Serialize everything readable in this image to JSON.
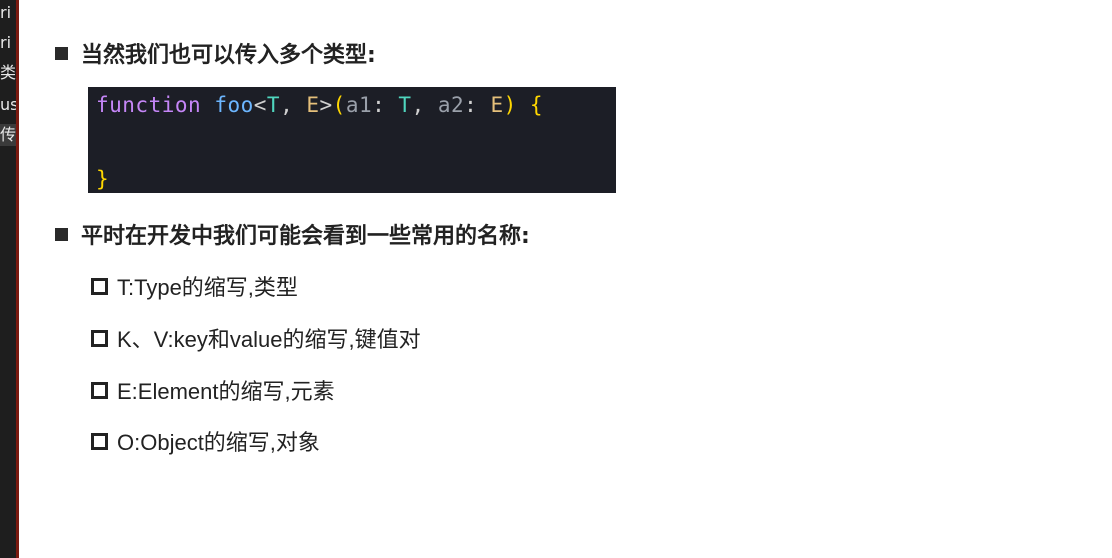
{
  "edge_items": [
    {
      "text": "ri"
    },
    {
      "text": "ri"
    },
    {
      "text": "类"
    },
    {
      "text": "us"
    },
    {
      "text": "传"
    }
  ],
  "section1": {
    "heading": "当然我们也可以传入多个类型:"
  },
  "code": {
    "line1": {
      "kw": "function",
      "fn": "foo",
      "lt": "<",
      "t1": "T",
      "comma1": ", ",
      "t2": "E",
      "gt": ">",
      "lparen": "(",
      "p1": "a1",
      "colon1": ": ",
      "pt1": "T",
      "comma2": ", ",
      "p2": "a2",
      "colon2": ": ",
      "pt2": "E",
      "rparen": ")",
      "lbrace": " {"
    },
    "line3": {
      "rbrace": "}"
    }
  },
  "section2": {
    "heading": "平时在开发中我们可能会看到一些常用的名称:",
    "items": [
      {
        "text": "T:Type的缩写,类型"
      },
      {
        "text": "K、V:key和value的缩写,键值对"
      },
      {
        "text": "E:Element的缩写,元素"
      },
      {
        "text": "O:Object的缩写,对象"
      }
    ]
  }
}
